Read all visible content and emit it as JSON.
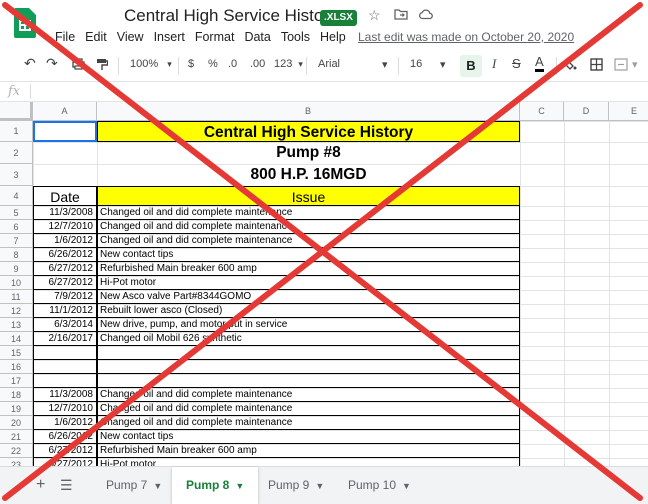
{
  "titlebar": {
    "doc_title": "Central High Service History",
    "file_badge": ".XLSX",
    "last_edit": "Last edit was made on October 20, 2020",
    "icons": [
      "star-icon",
      "folder-move-icon",
      "cloud-status-icon"
    ]
  },
  "menubar": {
    "items": [
      {
        "label": "File"
      },
      {
        "label": "Edit"
      },
      {
        "label": "View"
      },
      {
        "label": "Insert"
      },
      {
        "label": "Format"
      },
      {
        "label": "Data"
      },
      {
        "label": "Tools"
      },
      {
        "label": "Help"
      }
    ]
  },
  "toolbar": {
    "zoom": "100%",
    "currency": "$",
    "percent": "%",
    "dec_decrease": ".0",
    "dec_increase": ".00",
    "more_formats": "123",
    "font": "Arial",
    "font_size": "16",
    "bold": "B",
    "italic": "I",
    "strike": "S",
    "text_color": "A"
  },
  "formula_bar": {
    "fx": "fx",
    "value": ""
  },
  "grid": {
    "columns": [
      "A",
      "B",
      "C",
      "D",
      "E"
    ],
    "rows": [
      "1",
      "2",
      "3",
      "4",
      "5",
      "6",
      "7",
      "8",
      "9",
      "10",
      "11",
      "12",
      "13",
      "14",
      "15",
      "16",
      "17",
      "18",
      "19",
      "20",
      "21",
      "22",
      "23"
    ],
    "title": "Central High Service History",
    "pump": "Pump #8",
    "spec": "800 H.P. 16MGD",
    "hdr_date": "Date",
    "hdr_issue": "Issue",
    "entries": [
      {
        "date": "11/3/2008",
        "issue": "Changed oil and did complete maintenance"
      },
      {
        "date": "12/7/2010",
        "issue": "Changed oil and did complete maintenance"
      },
      {
        "date": "1/6/2012",
        "issue": "Changed oil and did complete maintenance"
      },
      {
        "date": "6/26/2012",
        "issue": "New contact tips"
      },
      {
        "date": "6/27/2012",
        "issue": "Refurbished Main breaker 600 amp"
      },
      {
        "date": "6/27/2012",
        "issue": "Hi-Pot motor"
      },
      {
        "date": "7/9/2012",
        "issue": "New Asco valve Part#8344GOMO"
      },
      {
        "date": "11/1/2012",
        "issue": "Rebuilt lower asco (Closed)"
      },
      {
        "date": "6/3/2014",
        "issue": "New drive, pump, and motor put in service"
      },
      {
        "date": "2/16/2017",
        "issue": "Changed oil Mobil 626 synthetic"
      },
      {
        "date": "",
        "issue": ""
      },
      {
        "date": "",
        "issue": ""
      },
      {
        "date": "",
        "issue": ""
      },
      {
        "date": "11/3/2008",
        "issue": "Changed oil and did complete maintenance"
      },
      {
        "date": "12/7/2010",
        "issue": "Changed oil and did complete maintenance"
      },
      {
        "date": "1/6/2012",
        "issue": "Changed oil and did complete maintenance"
      },
      {
        "date": "6/26/2012",
        "issue": "New contact tips"
      },
      {
        "date": "6/27/2012",
        "issue": "Refurbished Main breaker 600 amp"
      },
      {
        "date": "6/27/2012",
        "issue": "Hi-Pot motor"
      }
    ]
  },
  "sheets": {
    "tabs": [
      {
        "label": "Pump 7",
        "active": false
      },
      {
        "label": "Pump 8",
        "active": true
      },
      {
        "label": "Pump 9",
        "active": false
      },
      {
        "label": "Pump 10",
        "active": false
      }
    ]
  },
  "colors": {
    "yellow_fill": "#ffff00",
    "sheets_green": "#0f9d58",
    "active_tab_green": "#188038",
    "overlay_red": "#e53935"
  }
}
